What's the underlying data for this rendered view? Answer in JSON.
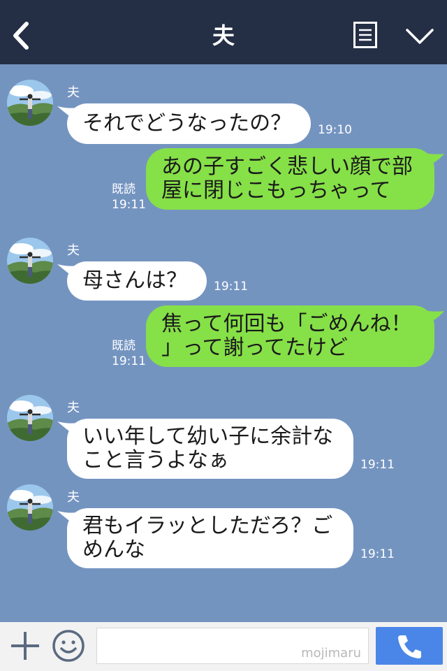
{
  "header": {
    "back_icon": "chevron-left-icon",
    "title": "夫",
    "menu_icon": "menu-icon",
    "collapse_icon": "chevron-down-icon"
  },
  "messages": [
    {
      "side": "in",
      "sender": "夫",
      "text": "それでどうなったの？",
      "time": "19:10"
    },
    {
      "side": "out",
      "read": "既読",
      "text": [
        "あの子すごく悲しい顔で部",
        "屋に閉じこもっちゃって"
      ],
      "time": "19:11"
    },
    {
      "side": "in",
      "sender": "夫",
      "text": "母さんは？",
      "time": "19:11"
    },
    {
      "side": "out",
      "read": "既読",
      "text": [
        "焦って何回も「ごめんね！",
        "」って謝ってたけど"
      ],
      "time": "19:11"
    },
    {
      "side": "in",
      "sender": "夫",
      "text": [
        "いい年して幼い子に余計な",
        "こと言うよなぁ"
      ],
      "time": "19:11"
    },
    {
      "side": "in",
      "sender": "夫",
      "text": [
        "君もイラッとしただろ？ご",
        "めんな"
      ],
      "time": "19:11"
    }
  ],
  "footer": {
    "plus_icon": "plus-icon",
    "emoji_icon": "emoji-icon",
    "watermark": "mojimaru",
    "call_icon": "phone-icon",
    "send_color": "#4a86e8"
  },
  "colors": {
    "background": "#7494c0",
    "header": "#242e44",
    "bubble_in": "#ffffff",
    "bubble_out": "#86e048"
  }
}
